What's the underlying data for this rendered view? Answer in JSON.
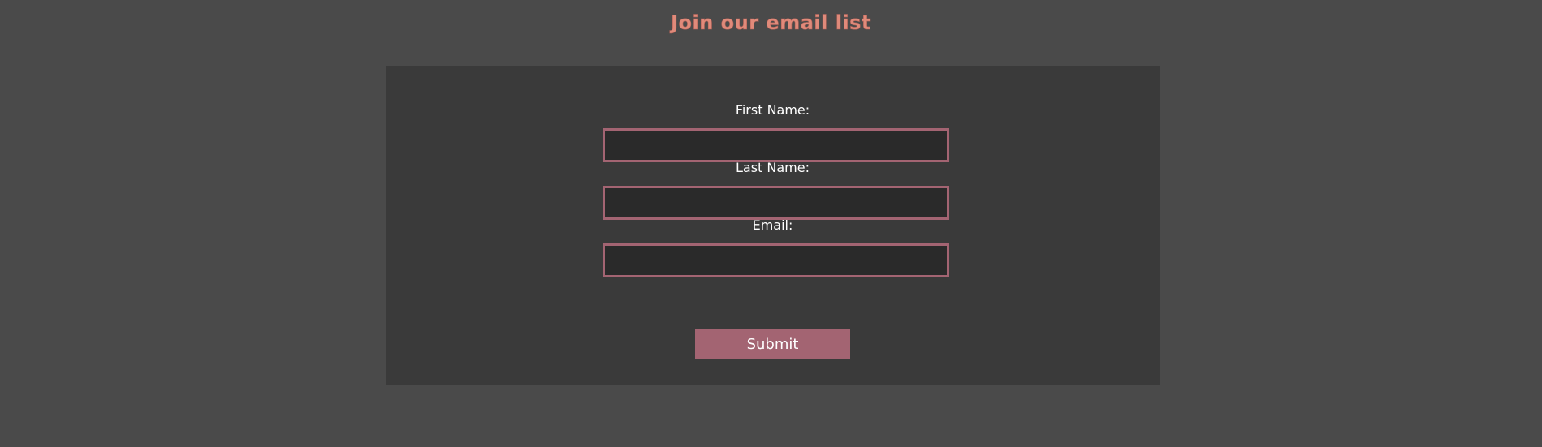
{
  "header": {
    "title": "Join our email list"
  },
  "form": {
    "fields": [
      {
        "label": "First Name:",
        "value": "",
        "placeholder": ""
      },
      {
        "label": "Last Name:",
        "value": "",
        "placeholder": ""
      },
      {
        "label": "Email:",
        "value": "",
        "placeholder": ""
      }
    ],
    "submit_label": "Submit"
  },
  "colors": {
    "page_background": "#4a4a4a",
    "panel_background": "#3a3a3a",
    "input_background": "#2a2a2a",
    "accent": "#a36472",
    "title": "#e08a7a"
  }
}
